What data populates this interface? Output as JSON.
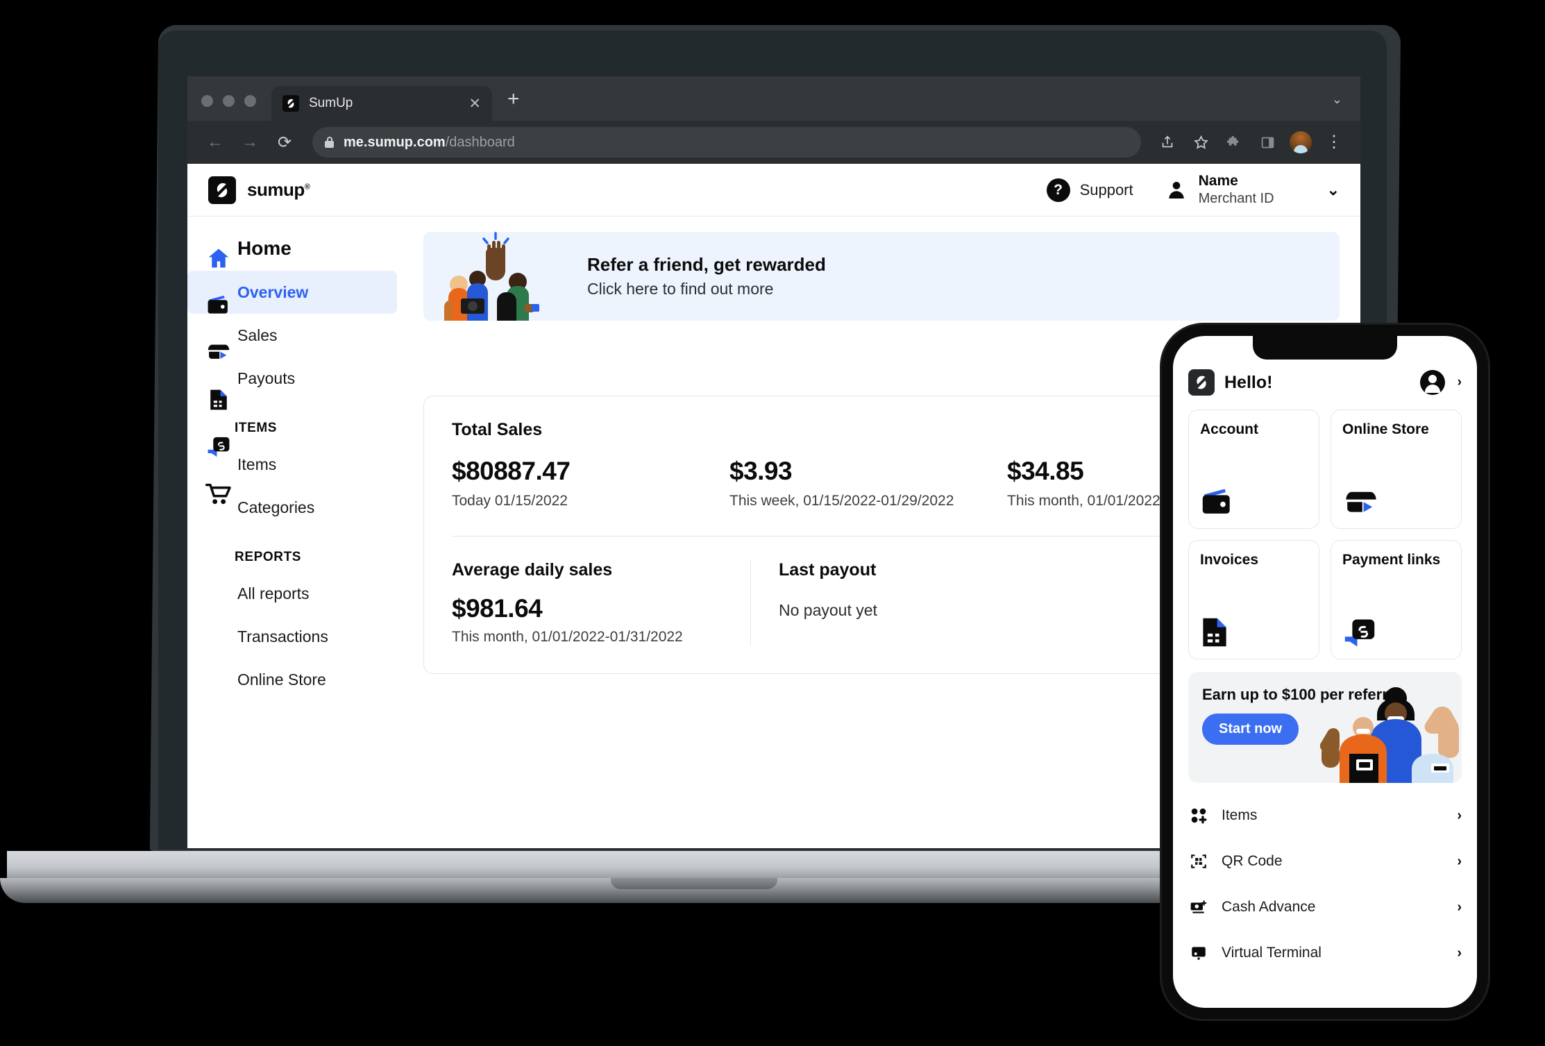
{
  "browser": {
    "tab": {
      "title": "SumUp",
      "close_label": "✕",
      "favicon": "sumup-logo-icon"
    },
    "new_tab_label": "+",
    "tab_list_chevron": "⌄",
    "nav": {
      "back": "←",
      "forward": "→",
      "reload": "⟳"
    },
    "url_domain": "me.sumup.com",
    "url_path": "/dashboard",
    "toolbar_icons": [
      "share-icon",
      "bookmark-star-icon",
      "extensions-puzzle-icon",
      "side-panel-icon",
      "profile-avatar-icon",
      "browser-menu-kebab-icon"
    ]
  },
  "app": {
    "brand": {
      "word": "sumup",
      "registered": "®"
    },
    "support_label": "Support",
    "support_icon_glyph": "?",
    "account": {
      "name": "Name",
      "merchant_id": "Merchant ID",
      "chevron": "⌄"
    }
  },
  "sidebar": {
    "title": "Home",
    "rail_icons": [
      "home-icon",
      "wallet-icon",
      "storefront-icon",
      "invoice-document-icon",
      "payment-link-icon",
      "shopping-cart-icon"
    ],
    "primary_items": [
      {
        "label": "Overview",
        "active": true
      },
      {
        "label": "Sales",
        "active": false
      },
      {
        "label": "Payouts",
        "active": false
      }
    ],
    "groups": [
      {
        "heading": "ITEMS",
        "items": [
          {
            "label": "Items"
          },
          {
            "label": "Categories"
          }
        ]
      },
      {
        "heading": "REPORTS",
        "items": [
          {
            "label": "All reports"
          },
          {
            "label": "Transactions"
          },
          {
            "label": "Online Store"
          }
        ]
      }
    ]
  },
  "banner": {
    "headline": "Refer a friend, get rewarded",
    "subline": "Click here to find out more"
  },
  "total_sales_card": {
    "heading": "Total Sales",
    "stats": [
      {
        "value": "$80887.47",
        "period": "Today 01/15/2022"
      },
      {
        "value": "$3.93",
        "period": "This week, 01/15/2022-01/29/2022"
      },
      {
        "value": "$34.85",
        "period": "This month, 01/01/2022-01/31/2022"
      }
    ],
    "average_daily_sales": {
      "heading": "Average daily sales",
      "value": "$981.64",
      "period": "This month, 01/01/2022-01/31/2022"
    },
    "last_payout": {
      "heading": "Last payout",
      "value": "No payout yet"
    }
  },
  "phone": {
    "greeting": "Hello!",
    "profile_chevron": "›",
    "tiles": [
      {
        "label": "Account",
        "icon": "wallet-icon"
      },
      {
        "label": "Online Store",
        "icon": "storefront-icon"
      },
      {
        "label": "Invoices",
        "icon": "invoice-document-icon"
      },
      {
        "label": "Payment links",
        "icon": "payment-link-icon"
      }
    ],
    "promo": {
      "headline": "Earn up to $100 per referral",
      "button_label": "Start now"
    },
    "list": [
      {
        "label": "Items",
        "icon": "items-grid-plus-icon",
        "chevron": "›"
      },
      {
        "label": "QR Code",
        "icon": "qr-code-icon",
        "chevron": "›"
      },
      {
        "label": "Cash Advance",
        "icon": "cash-advance-icon",
        "chevron": "›"
      },
      {
        "label": "Virtual Terminal",
        "icon": "virtual-terminal-icon",
        "chevron": "›"
      }
    ]
  },
  "colors": {
    "accent_blue": "#2b62f0",
    "promo_blue": "#3b6ef0",
    "banner_bg": "#eef4fe",
    "active_nav_bg": "#e8f0fe"
  }
}
